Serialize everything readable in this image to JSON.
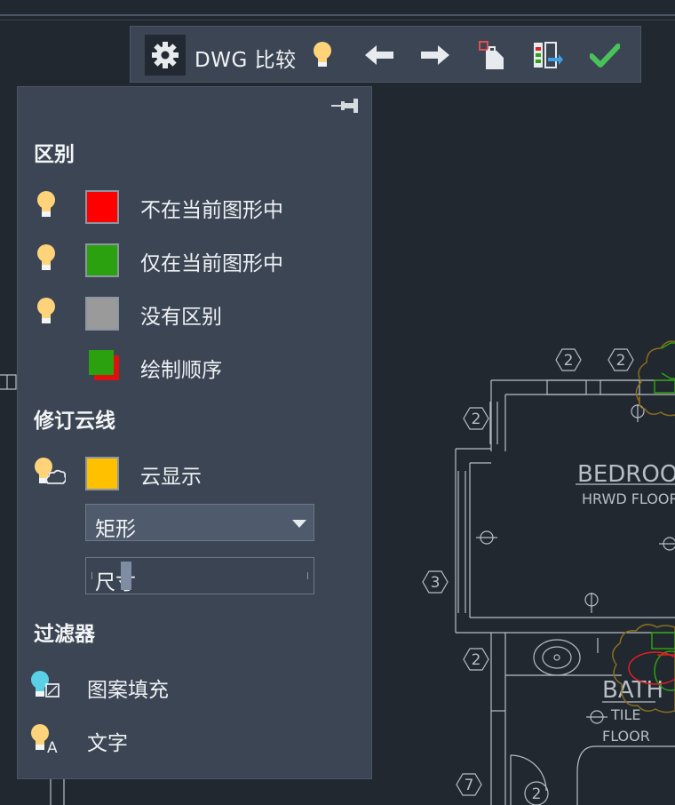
{
  "toolbar": {
    "title": "DWG 比较",
    "icons": [
      "gear-icon",
      "lightbulb-icon",
      "arrow-left-icon",
      "arrow-right-icon",
      "import-objects-icon",
      "export-snapshot-icon",
      "checkmark-icon"
    ]
  },
  "panel": {
    "differences": {
      "title": "区别",
      "items": [
        {
          "label": "不在当前图形中",
          "color": "#ff0000"
        },
        {
          "label": "仅在当前图形中",
          "color": "#2ca10f"
        },
        {
          "label": "没有区别",
          "color": "#9a9a9a"
        },
        {
          "label": "绘制顺序",
          "color": "#2ca10f"
        }
      ]
    },
    "revcloud": {
      "title": "修订云线",
      "cloud_label": "云显示",
      "cloud_color": "#ffc000",
      "shape_value": "矩形",
      "size_label": "尺寸",
      "size_level": 0.16
    },
    "filters": {
      "title": "过滤器",
      "hatch_label": "图案填充",
      "text_label": "文字"
    }
  },
  "drawing": {
    "room1": "BEDROOM",
    "floor1": "HRWD FLOOR",
    "room2": "BATH",
    "floor2a": "TILE",
    "floor2b": "FLOOR",
    "tags": [
      "2",
      "2",
      "2",
      "2",
      "3",
      "2",
      "7",
      "2"
    ]
  }
}
